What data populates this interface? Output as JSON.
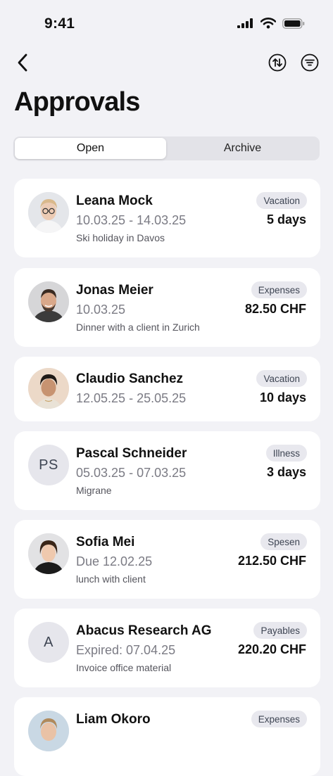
{
  "status_bar": {
    "time": "9:41"
  },
  "header": {
    "title": "Approvals"
  },
  "tabs": [
    {
      "label": "Open",
      "active": true
    },
    {
      "label": "Archive",
      "active": false
    }
  ],
  "approvals": [
    {
      "name": "Leana Mock",
      "dates": "10.03.25 - 14.03.25",
      "note": "Ski holiday in Davos",
      "badge": "Vacation",
      "amount": "5 days",
      "avatar": "photo"
    },
    {
      "name": "Jonas Meier",
      "dates": "10.03.25",
      "note": "Dinner with a client in Zurich",
      "badge": "Expenses",
      "amount": "82.50 CHF",
      "avatar": "photo"
    },
    {
      "name": "Claudio Sanchez",
      "dates": "12.05.25 - 25.05.25",
      "note": "",
      "badge": "Vacation",
      "amount": "10 days",
      "avatar": "photo"
    },
    {
      "name": "Pascal Schneider",
      "dates": "05.03.25 - 07.03.25",
      "note": "Migrane",
      "badge": "Illness",
      "amount": "3 days",
      "avatar": "initials",
      "initials": "PS"
    },
    {
      "name": "Sofia Mei",
      "dates": "Due 12.02.25",
      "note": "lunch with client",
      "badge": "Spesen",
      "amount": "212.50 CHF",
      "avatar": "photo"
    },
    {
      "name": "Abacus Research AG",
      "dates": "Expired: 07.04.25",
      "note": "Invoice office material",
      "badge": "Payables",
      "amount": "220.20 CHF",
      "avatar": "initials",
      "initials": "A"
    },
    {
      "name": "Liam Okoro",
      "dates": "",
      "note": "",
      "badge": "Expenses",
      "amount": "",
      "avatar": "photo"
    }
  ]
}
